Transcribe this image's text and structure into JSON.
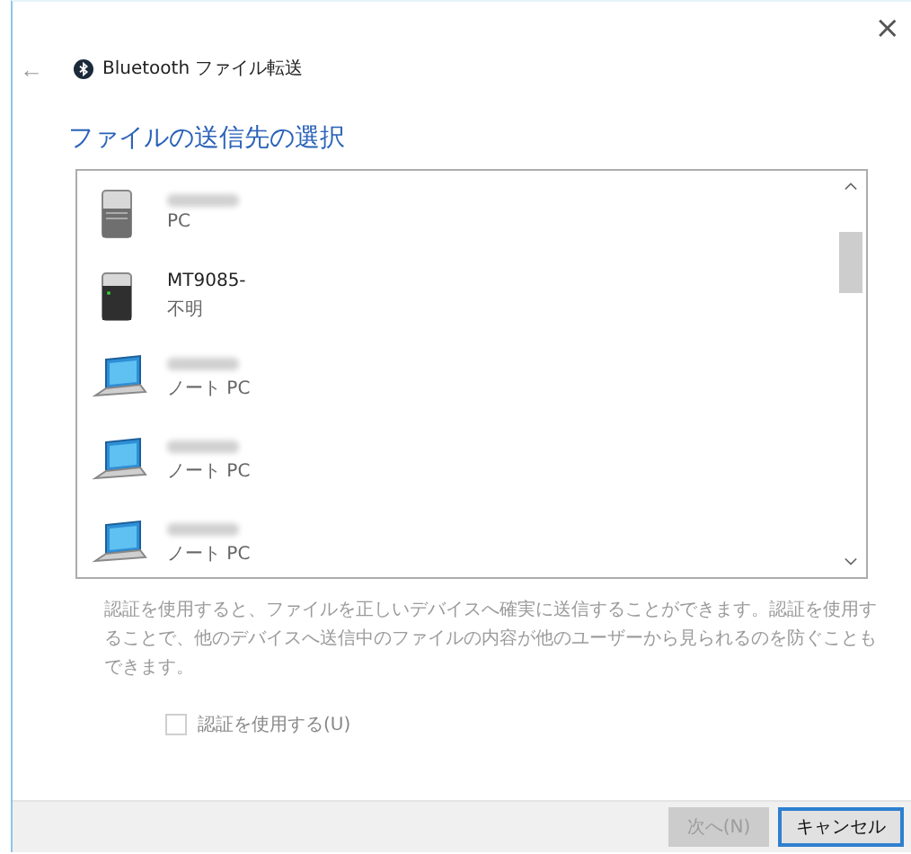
{
  "window": {
    "app_title": "Bluetooth ファイル転送",
    "close": "×",
    "back": "←"
  },
  "heading": "ファイルの送信先の選択",
  "devices": [
    {
      "kind": "tower",
      "name_blurred": true,
      "type": "PC"
    },
    {
      "kind": "tower-dark",
      "name": "MT9085-",
      "type": "不明"
    },
    {
      "kind": "laptop",
      "name_blurred": true,
      "type": "ノート PC"
    },
    {
      "kind": "laptop",
      "name_blurred": true,
      "type": "ノート PC"
    },
    {
      "kind": "laptop",
      "name_blurred": true,
      "type": "ノート PC"
    }
  ],
  "description": "認証を使用すると、ファイルを正しいデバイスへ確実に送信することができます。認証を使用することで、他のデバイスへ送信中のファイルの内容が他のユーザーから見られるのを防ぐこともできます。",
  "auth_checkbox": {
    "label": "認証を使用する(U)",
    "checked": false,
    "disabled": true
  },
  "buttons": [
    {
      "label": "次へ(N)",
      "disabled": true,
      "default": false
    },
    {
      "label": "キャンセル",
      "disabled": false,
      "default": true
    }
  ]
}
